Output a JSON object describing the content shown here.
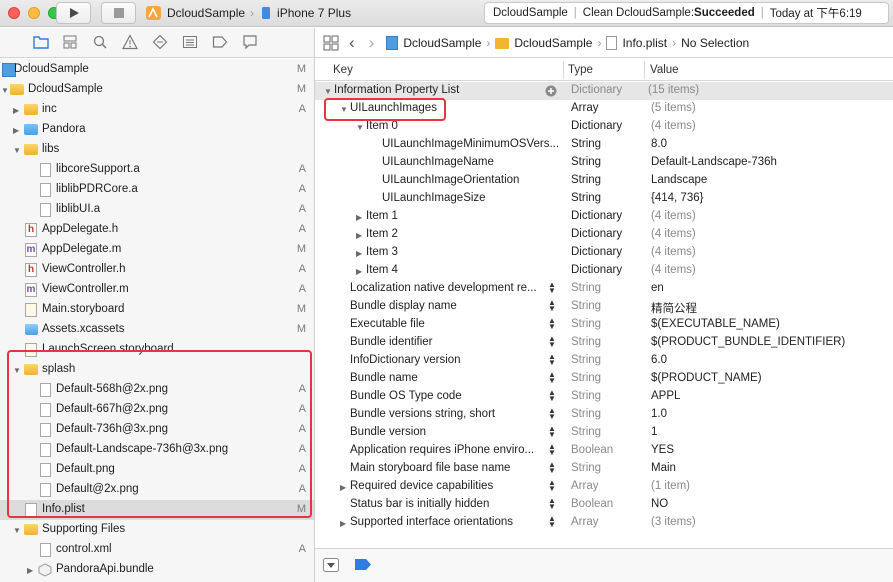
{
  "toolbar": {
    "scheme_name": "DcloudSample",
    "device_name": "iPhone 7 Plus",
    "status_project": "DcloudSample",
    "status_prefix": "Clean DcloudSample: ",
    "status_result": "Succeeded",
    "status_time": "Today at 下午6:19"
  },
  "jumpbar": {
    "crumbs": [
      "DcloudSample",
      "DcloudSample",
      "Info.plist",
      "No Selection"
    ]
  },
  "navigator": {
    "items": [
      {
        "label": "DcloudSample",
        "badge": "M"
      },
      {
        "label": "DcloudSample",
        "badge": "M"
      },
      {
        "label": "inc",
        "badge": "A"
      },
      {
        "label": "Pandora",
        "badge": ""
      },
      {
        "label": "libs",
        "badge": ""
      },
      {
        "label": "libcoreSupport.a",
        "badge": "A"
      },
      {
        "label": "liblibPDRCore.a",
        "badge": "A"
      },
      {
        "label": "liblibUI.a",
        "badge": "A"
      },
      {
        "label": "AppDelegate.h",
        "badge": "A"
      },
      {
        "label": "AppDelegate.m",
        "badge": "M"
      },
      {
        "label": "ViewController.h",
        "badge": "A"
      },
      {
        "label": "ViewController.m",
        "badge": "A"
      },
      {
        "label": "Main.storyboard",
        "badge": "M"
      },
      {
        "label": "Assets.xcassets",
        "badge": "M"
      },
      {
        "label": "LaunchScreen.storyboard",
        "badge": ""
      },
      {
        "label": "splash",
        "badge": ""
      },
      {
        "label": "Default-568h@2x.png",
        "badge": "A"
      },
      {
        "label": "Default-667h@2x.png",
        "badge": "A"
      },
      {
        "label": "Default-736h@3x.png",
        "badge": "A"
      },
      {
        "label": "Default-Landscape-736h@3x.png",
        "badge": "A"
      },
      {
        "label": "Default.png",
        "badge": "A"
      },
      {
        "label": "Default@2x.png",
        "badge": "A"
      },
      {
        "label": "Info.plist",
        "badge": "M"
      },
      {
        "label": "Supporting Files",
        "badge": ""
      },
      {
        "label": "control.xml",
        "badge": "A"
      },
      {
        "label": "PandoraApi.bundle",
        "badge": ""
      }
    ]
  },
  "plist": {
    "headers": {
      "key": "Key",
      "type": "Type",
      "value": "Value"
    },
    "rows": [
      {
        "key": "Information Property List",
        "type": "Dictionary",
        "value": "(15 items)"
      },
      {
        "key": "UILaunchImages",
        "type": "Array",
        "value": "(5 items)"
      },
      {
        "key": "Item 0",
        "type": "Dictionary",
        "value": "(4 items)"
      },
      {
        "key": "UILaunchImageMinimumOSVers...",
        "type": "String",
        "value": "8.0"
      },
      {
        "key": "UILaunchImageName",
        "type": "String",
        "value": "Default-Landscape-736h"
      },
      {
        "key": "UILaunchImageOrientation",
        "type": "String",
        "value": "Landscape"
      },
      {
        "key": "UILaunchImageSize",
        "type": "String",
        "value": "{414, 736}"
      },
      {
        "key": "Item 1",
        "type": "Dictionary",
        "value": "(4 items)"
      },
      {
        "key": "Item 2",
        "type": "Dictionary",
        "value": "(4 items)"
      },
      {
        "key": "Item 3",
        "type": "Dictionary",
        "value": "(4 items)"
      },
      {
        "key": "Item 4",
        "type": "Dictionary",
        "value": "(4 items)"
      },
      {
        "key": "Localization native development re...",
        "type": "String",
        "value": "en"
      },
      {
        "key": "Bundle display name",
        "type": "String",
        "value": "精简公程"
      },
      {
        "key": "Executable file",
        "type": "String",
        "value": "$(EXECUTABLE_NAME)"
      },
      {
        "key": "Bundle identifier",
        "type": "String",
        "value": "$(PRODUCT_BUNDLE_IDENTIFIER)"
      },
      {
        "key": "InfoDictionary version",
        "type": "String",
        "value": "6.0"
      },
      {
        "key": "Bundle name",
        "type": "String",
        "value": "$(PRODUCT_NAME)"
      },
      {
        "key": "Bundle OS Type code",
        "type": "String",
        "value": "APPL"
      },
      {
        "key": "Bundle versions string, short",
        "type": "String",
        "value": "1.0"
      },
      {
        "key": "Bundle version",
        "type": "String",
        "value": "1"
      },
      {
        "key": "Application requires iPhone enviro...",
        "type": "Boolean",
        "value": "YES"
      },
      {
        "key": "Main storyboard file base name",
        "type": "String",
        "value": "Main"
      },
      {
        "key": "Required device capabilities",
        "type": "Array",
        "value": "(1 item)"
      },
      {
        "key": "Status bar is initially hidden",
        "type": "Boolean",
        "value": "NO"
      },
      {
        "key": "Supported interface orientations",
        "type": "Array",
        "value": "(3 items)"
      }
    ]
  },
  "colors": {
    "highlight_box": "#e8343f",
    "accent": "#2f7de1"
  }
}
